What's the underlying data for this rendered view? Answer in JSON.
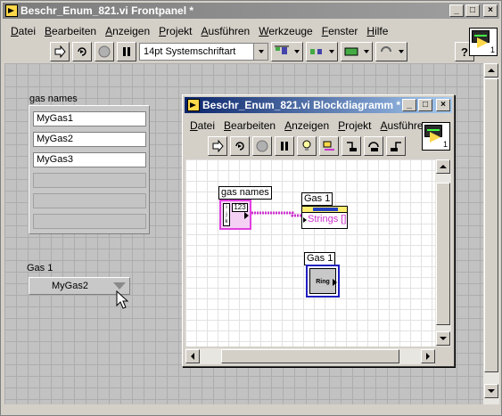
{
  "front_panel": {
    "title": "Beschr_Enum_821.vi Frontpanel *",
    "menu": [
      "Datei",
      "Bearbeiten",
      "Anzeigen",
      "Projekt",
      "Ausführen",
      "Werkzeuge",
      "Fenster",
      "Hilfe"
    ],
    "font_selector": "14pt Systemschriftart",
    "help_button": "?",
    "vi_icon_number": "1",
    "array_label": "gas names",
    "array_values": [
      "MyGas1",
      "MyGas2",
      "MyGas3"
    ],
    "ring_label": "Gas 1",
    "ring_value": "MyGas2"
  },
  "block_diagram": {
    "title": "Beschr_Enum_821.vi Blockdiagramm *",
    "menu": [
      "Datei",
      "Bearbeiten",
      "Anzeigen",
      "Projekt",
      "Ausführen"
    ],
    "vi_icon_number": "1",
    "array_terminal_label": "gas names",
    "array_terminal_type": "123",
    "property_node_label": "Gas 1",
    "property_node_property": "Strings []",
    "ring_terminal_label": "Gas 1",
    "ring_terminal_type": "Ring"
  },
  "window_buttons": {
    "minimize": "_",
    "maximize": "□",
    "close": "×"
  },
  "colors": {
    "title_active": "#0a246a",
    "title_inactive": "#808080",
    "wire_string_array": "#cc33cc",
    "ring_terminal": "#2020c0"
  }
}
